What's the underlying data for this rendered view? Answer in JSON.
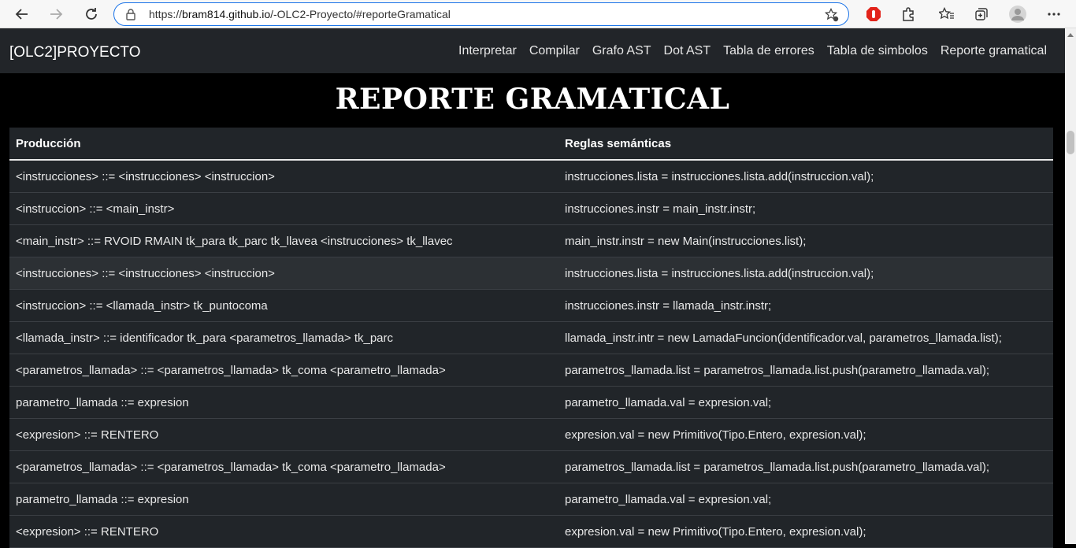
{
  "browser": {
    "url_prefix": "https://",
    "url_host": "bram814.github.io",
    "url_path": "/-OLC2-Proyecto/#reporteGramatical"
  },
  "navbar": {
    "brand": "[OLC2]PROYECTO",
    "links": [
      "Interpretar",
      "Compilar",
      "Grafo AST",
      "Dot AST",
      "Tabla de errores",
      "Tabla de simbolos",
      "Reporte gramatical"
    ]
  },
  "page": {
    "title": "REPORTE GRAMATICAL"
  },
  "table": {
    "headers": [
      "Producción",
      "Reglas semánticas"
    ],
    "rows": [
      [
        "<instrucciones> ::= <instrucciones> <instruccion>",
        "instrucciones.lista = instrucciones.lista.add(instruccion.val);"
      ],
      [
        "<instruccion> ::= <main_instr>",
        "instrucciones.instr = main_instr.instr;"
      ],
      [
        "<main_instr> ::= RVOID RMAIN tk_para tk_parc tk_llavea <instrucciones> tk_llavec",
        "main_instr.instr = new Main(instrucciones.list);"
      ],
      [
        "<instrucciones> ::= <instrucciones> <instruccion>",
        "instrucciones.lista = instrucciones.lista.add(instruccion.val);"
      ],
      [
        "<instruccion> ::= <llamada_instr> tk_puntocoma",
        "instrucciones.instr = llamada_instr.instr;"
      ],
      [
        "<llamada_instr> ::= identificador tk_para <parametros_llamada> tk_parc",
        "llamada_instr.intr = new LamadaFuncion(identificador.val, parametros_llamada.list);"
      ],
      [
        "<parametros_llamada> ::= <parametros_llamada> tk_coma <parametro_llamada>",
        "parametros_llamada.list = parametros_llamada.list.push(parametro_llamada.val);"
      ],
      [
        "parametro_llamada ::= expresion",
        "parametro_llamada.val = expresion.val;"
      ],
      [
        "<expresion> ::= RENTERO",
        "expresion.val = new Primitivo(Tipo.Entero, expresion.val);"
      ],
      [
        "<parametros_llamada> ::= <parametros_llamada> tk_coma <parametro_llamada>",
        "parametros_llamada.list = parametros_llamada.list.push(parametro_llamada.val);"
      ],
      [
        "parametro_llamada ::= expresion",
        "parametro_llamada.val = expresion.val;"
      ],
      [
        "<expresion> ::= RENTERO",
        "expresion.val = new Primitivo(Tipo.Entero, expresion.val);"
      ]
    ]
  }
}
